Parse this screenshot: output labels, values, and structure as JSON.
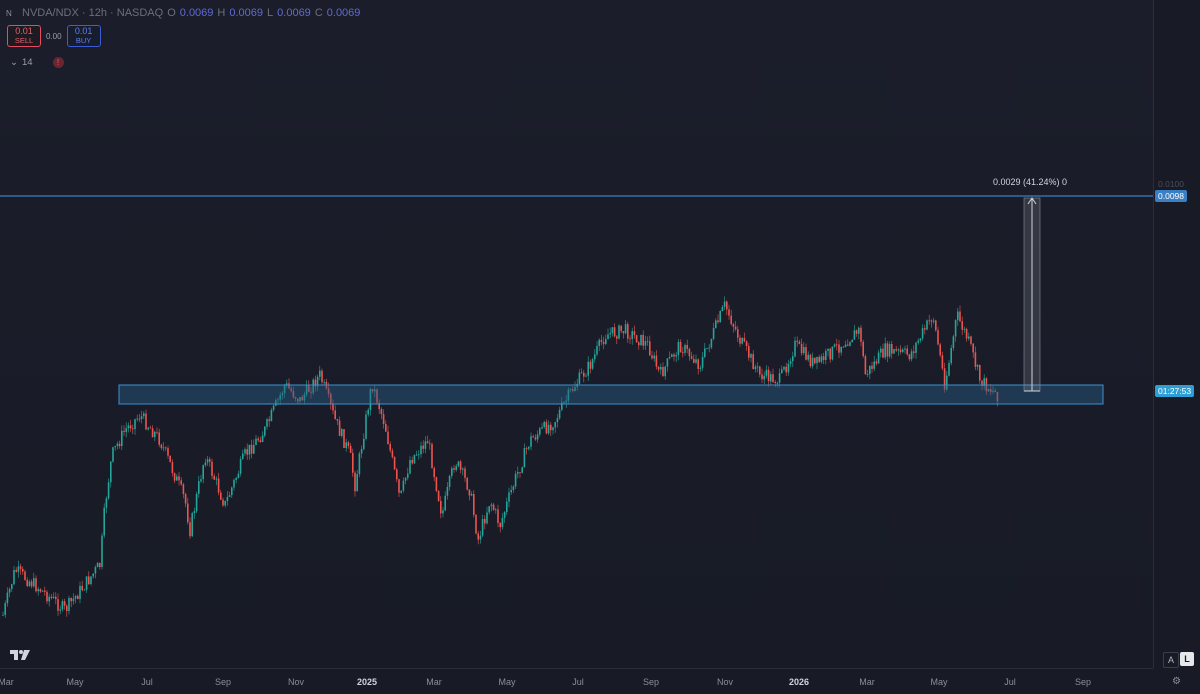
{
  "header": {
    "symbol_icon": "N",
    "title": "NVDA/NDX · 12h · NASDAQ",
    "ohlc": {
      "o_label": "O",
      "o": "0.0069",
      "h_label": "H",
      "h": "0.0069",
      "l_label": "L",
      "l": "0.0069",
      "c_label": "C",
      "c": "0.0069"
    }
  },
  "trade": {
    "sell_price": "0.01",
    "sell_label": "SELL",
    "spread": "0.00",
    "buy_price": "0.01",
    "buy_label": "BUY"
  },
  "indicators": {
    "collapse_icon": "chevron-down-icon",
    "count": "14",
    "alert_icon": "!"
  },
  "price_axis": {
    "top_label": "0.0100",
    "resistance_label": "0.0098",
    "countdown_label": "01:27:53"
  },
  "measure_label": "0.0029 (41.24%) 0",
  "time_axis": [
    {
      "label": "Mar",
      "bold": false
    },
    {
      "label": "May",
      "bold": false
    },
    {
      "label": "Jul",
      "bold": false
    },
    {
      "label": "Sep",
      "bold": false
    },
    {
      "label": "Nov",
      "bold": false
    },
    {
      "label": "2025",
      "bold": true
    },
    {
      "label": "Mar",
      "bold": false
    },
    {
      "label": "May",
      "bold": false
    },
    {
      "label": "Jul",
      "bold": false
    },
    {
      "label": "Sep",
      "bold": false
    },
    {
      "label": "Nov",
      "bold": false
    },
    {
      "label": "2026",
      "bold": true
    },
    {
      "label": "Mar",
      "bold": false
    },
    {
      "label": "May",
      "bold": false
    },
    {
      "label": "Jul",
      "bold": false
    },
    {
      "label": "Sep",
      "bold": false
    }
  ],
  "corner_buttons": {
    "auto": "A",
    "log": "L"
  },
  "colors": {
    "up": "#26a69a",
    "down": "#ef5350",
    "resistance": "#3a7fc4",
    "zone": "#2b5d85",
    "countdown": "#2e9fd6"
  }
}
